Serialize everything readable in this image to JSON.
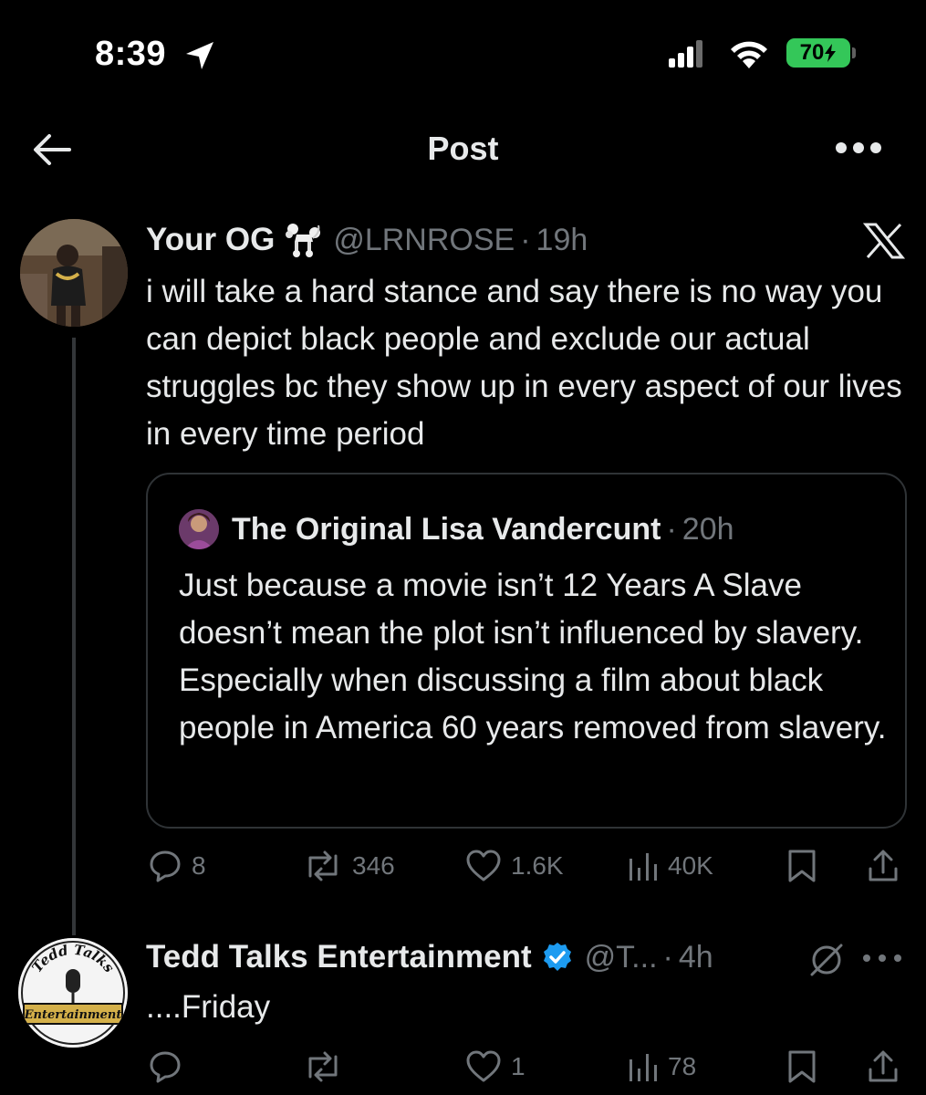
{
  "status_bar": {
    "time": "8:39",
    "battery": "70",
    "icons": [
      "location-arrow-icon",
      "cellular-signal-icon",
      "wifi-icon",
      "battery-charging-icon"
    ]
  },
  "nav": {
    "title": "Post",
    "back_icon": "arrow-left-icon",
    "more_icon": "more-horizontal-icon"
  },
  "main_post": {
    "author_name": "Your OG",
    "author_emoji": "poodle-icon",
    "handle": "@LRNROSE",
    "separator": "·",
    "time": "19h",
    "platform_icon": "x-logo-icon",
    "text": "i will take a hard stance and say there is no way you can depict black people and exclude our actual struggles bc they show up in every aspect of our lives in every time period",
    "quote": {
      "author_name": "The Original Lisa Vandercunt",
      "separator": "·",
      "time": "20h",
      "text": "Just because a movie isn’t 12 Years A Slave doesn’t mean the plot isn’t influenced by slavery. Especially when discussing a film about black people in America 60 years removed from slavery."
    },
    "stats": {
      "replies": "8",
      "reposts": "346",
      "likes": "1.6K",
      "views": "40K"
    }
  },
  "reply_post": {
    "author_name": "Tedd Talks Entertainment",
    "handle": "@T...",
    "separator": "·",
    "time": "4h",
    "text": "....Friday",
    "avatar_logo": {
      "line1": "Tedd Talks",
      "line2": "Entertainment"
    },
    "stats": {
      "replies": "",
      "reposts": "",
      "likes": "1",
      "views": "78"
    }
  },
  "colors": {
    "background": "#000000",
    "text_primary": "#e7e9ea",
    "text_secondary": "#71767b",
    "border": "#2f3336",
    "verified_blue": "#1d9bf0",
    "battery_green": "#34c759"
  }
}
